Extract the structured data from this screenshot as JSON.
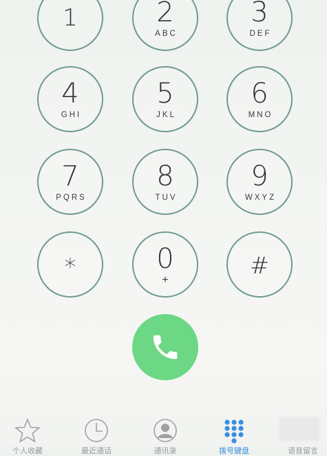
{
  "keypad": [
    {
      "digit": "1",
      "letters": ""
    },
    {
      "digit": "2",
      "letters": "ABC"
    },
    {
      "digit": "3",
      "letters": "DEF"
    },
    {
      "digit": "4",
      "letters": "GHI"
    },
    {
      "digit": "5",
      "letters": "JKL"
    },
    {
      "digit": "6",
      "letters": "MNO"
    },
    {
      "digit": "7",
      "letters": "PQRS"
    },
    {
      "digit": "8",
      "letters": "TUV"
    },
    {
      "digit": "9",
      "letters": "WXYZ"
    },
    {
      "digit": "*",
      "letters": ""
    },
    {
      "digit": "0",
      "letters": "+"
    },
    {
      "digit": "#",
      "letters": ""
    }
  ],
  "call_button": {
    "icon": "phone-icon",
    "color": "#6cd784"
  },
  "tabbar": {
    "tabs": [
      {
        "icon": "star-icon",
        "label": "个人收藏",
        "active": false
      },
      {
        "icon": "clock-icon",
        "label": "最近通话",
        "active": false
      },
      {
        "icon": "contact-icon",
        "label": "通讯录",
        "active": false
      },
      {
        "icon": "keypad-icon",
        "label": "拨号键盘",
        "active": true
      },
      {
        "icon": "voicemail-icon",
        "label": "语音留言",
        "active": false
      }
    ]
  },
  "colors": {
    "accent": "#3a8ee0",
    "call_green": "#6cd784",
    "key_border": "#6f9a8c"
  }
}
